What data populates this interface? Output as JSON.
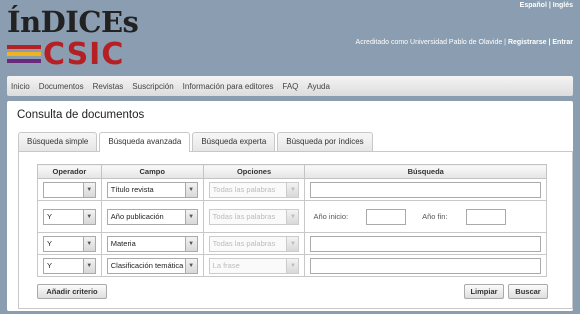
{
  "lang": {
    "es": "Español",
    "sep": "|",
    "en": "Inglés"
  },
  "logo": {
    "top": "ÍnDICEs",
    "bottom": "CSIC",
    "stripe_colors": [
      "#b52025",
      "#f1b220",
      "#6a2a7c"
    ]
  },
  "account": {
    "accredited": "Acreditado como Universidad Pablo de Olavide |",
    "register": "Registrarse",
    "sep": "|",
    "login": "Entrar"
  },
  "nav": [
    "Inicio",
    "Documentos",
    "Revistas",
    "Suscripción",
    "Información para editores",
    "FAQ",
    "Ayuda"
  ],
  "page_title": "Consulta de documentos",
  "tabs": [
    "Búsqueda simple",
    "Búsqueda avanzada",
    "Búsqueda experta",
    "Búsqueda por índices"
  ],
  "active_tab": 1,
  "table": {
    "headers": [
      "Operador",
      "Campo",
      "Opciones",
      "Búsqueda"
    ],
    "rows": [
      {
        "operator": "",
        "field": "Título revista",
        "option": "Todas las palabras"
      },
      {
        "operator": "Y",
        "field": "Año publicación",
        "option": "Todas las palabras",
        "from_label": "Año inicio:",
        "to_label": "Año fin:"
      },
      {
        "operator": "Y",
        "field": "Materia",
        "option": "Todas las palabras"
      },
      {
        "operator": "Y",
        "field": "Clasificación temática",
        "option": "La frase"
      }
    ]
  },
  "buttons": {
    "add": "Añadir criterio",
    "clear": "Limpiar",
    "search": "Buscar"
  }
}
